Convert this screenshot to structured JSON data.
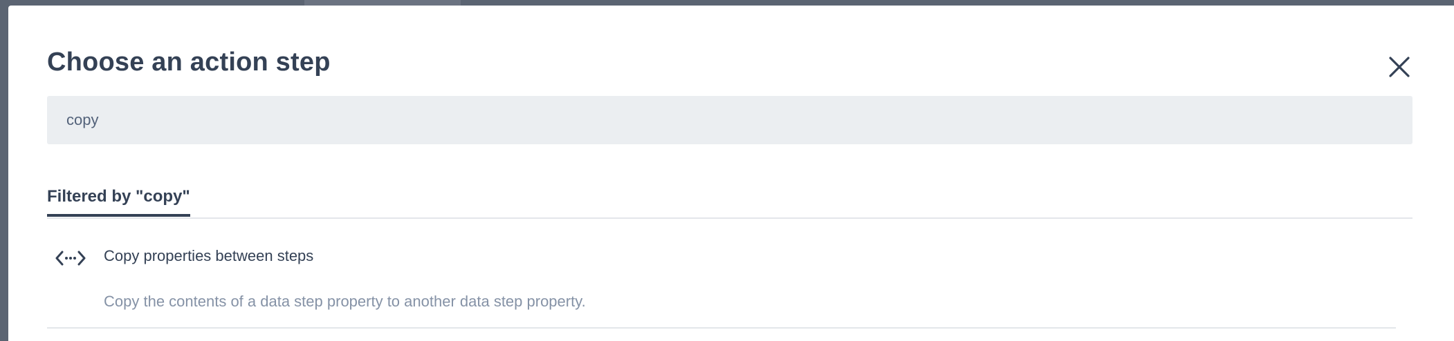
{
  "modal": {
    "title": "Choose an action step",
    "close_icon": "close-icon"
  },
  "search": {
    "value": "copy"
  },
  "tabs": [
    {
      "label": "Filtered by \"copy\"",
      "active": true
    }
  ],
  "results": [
    {
      "icon": "code-dots-icon",
      "title": "Copy properties between steps",
      "description": "Copy the contents of a data step property to another data step property."
    }
  ],
  "colors": {
    "overlay": "#5b6472",
    "title_text": "#344155",
    "search_bg": "#ebeef1",
    "muted_text": "#8592a6",
    "divider": "#e3e6ea"
  }
}
